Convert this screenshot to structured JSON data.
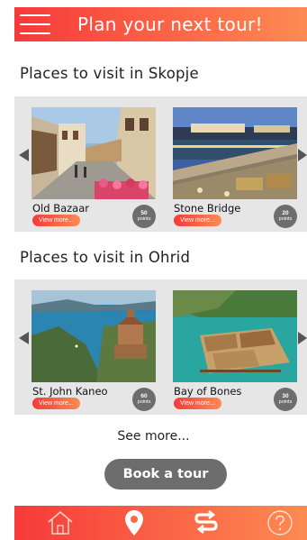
{
  "header": {
    "title": "Plan your next tour!",
    "menu_icon": "hamburger-menu-icon"
  },
  "sections": [
    {
      "title": "Places to visit in Skopje",
      "cards": [
        {
          "name": "Old Bazaar",
          "view_more": "View more...",
          "points_value": "50",
          "points_label": "points"
        },
        {
          "name": "Stone Bridge",
          "view_more": "View more...",
          "points_value": "20",
          "points_label": "points"
        }
      ]
    },
    {
      "title": "Places to visit in Ohrid",
      "cards": [
        {
          "name": "St. John Kaneo",
          "view_more": "View more...",
          "points_value": "60",
          "points_label": "points"
        },
        {
          "name": "Bay of Bones",
          "view_more": "View more...",
          "points_value": "30",
          "points_label": "points"
        }
      ]
    }
  ],
  "see_more": "See more...",
  "book_button": "Book a tour",
  "bottom_nav": {
    "items": [
      "home-icon",
      "location-pin-icon",
      "currency-exchange-icon",
      "help-question-icon"
    ]
  },
  "colors": {
    "gradient_start": "#f63a3a",
    "gradient_end": "#fc8b52",
    "carousel_bg": "#e6e6e6",
    "badge_grey": "#6d6d6d"
  }
}
